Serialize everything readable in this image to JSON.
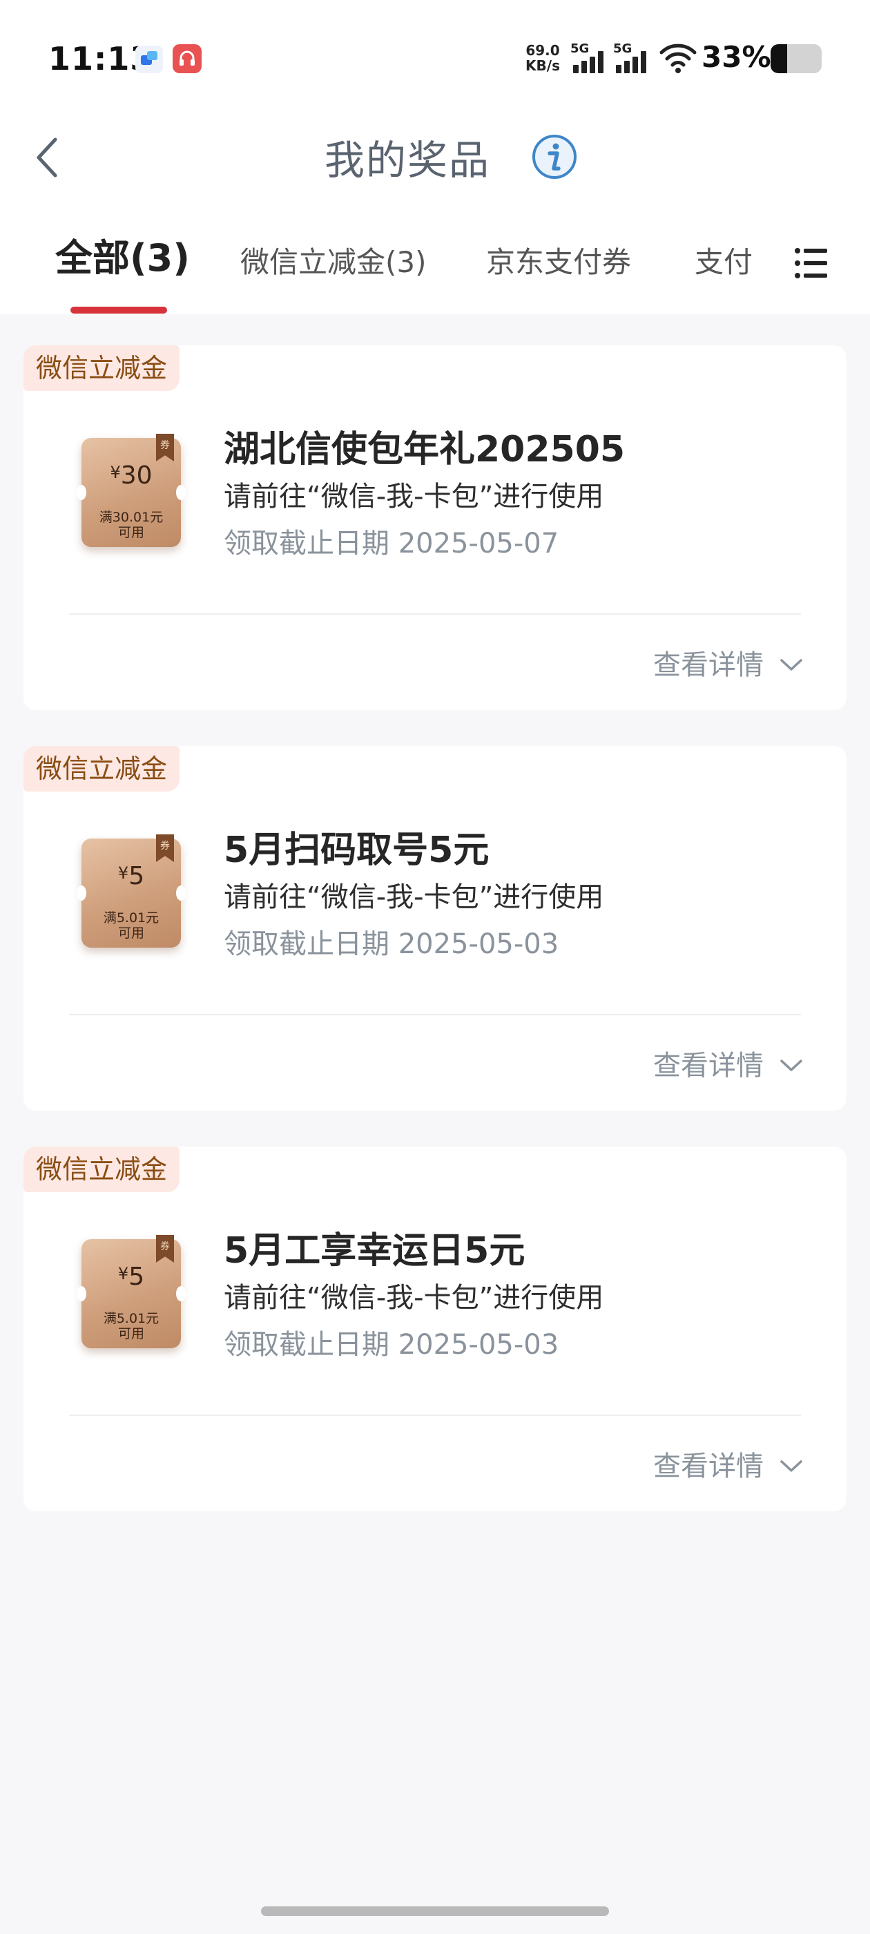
{
  "status_bar": {
    "time": "11:13",
    "net_speed_value": "69.0",
    "net_speed_unit": "KB/s",
    "signal_1_label": "5G",
    "signal_2_label": "5G",
    "battery_percent": "33%",
    "battery_level": 0.33
  },
  "header": {
    "title": "我的奖品"
  },
  "tabs": [
    {
      "label": "全部(3)",
      "active": true
    },
    {
      "label": "微信立减金(3)",
      "active": false
    },
    {
      "label": "京东支付券",
      "active": false
    },
    {
      "label": "支付",
      "active": false
    }
  ],
  "cards": [
    {
      "tag": "微信立减金",
      "coupon_badge": "券",
      "coupon_currency": "¥",
      "coupon_amount": "30",
      "coupon_condition": "满30.01元",
      "coupon_usable": "可用",
      "title": "湖北信使包年礼202505",
      "description": "请前往“微信-我-卡包”进行使用",
      "deadline": "领取截止日期 2025-05-07",
      "detail_label": "查看详情"
    },
    {
      "tag": "微信立减金",
      "coupon_badge": "券",
      "coupon_currency": "¥",
      "coupon_amount": "5",
      "coupon_condition": "满5.01元",
      "coupon_usable": "可用",
      "title": "5月扫码取号5元",
      "description": "请前往“微信-我-卡包”进行使用",
      "deadline": "领取截止日期 2025-05-03",
      "detail_label": "查看详情"
    },
    {
      "tag": "微信立减金",
      "coupon_badge": "券",
      "coupon_currency": "¥",
      "coupon_amount": "5",
      "coupon_condition": "满5.01元",
      "coupon_usable": "可用",
      "title": "5月工享幸运日5元",
      "description": "请前往“微信-我-卡包”进行使用",
      "deadline": "领取截止日期 2025-05-03",
      "detail_label": "查看详情"
    }
  ],
  "colors": {
    "accent_red": "#d8333a",
    "tag_background": "#fde8e4",
    "tag_text": "#8a4d12",
    "info_icon_blue": "#3f86c9"
  }
}
